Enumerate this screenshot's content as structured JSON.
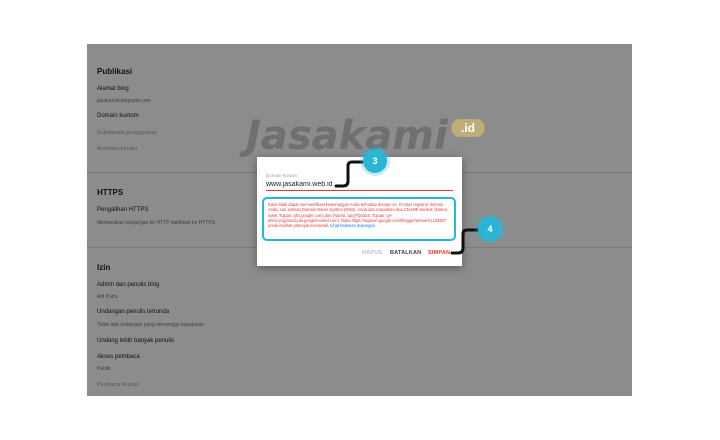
{
  "settings": {
    "publikasi": {
      "title": "Publikasi",
      "alamat_blog_label": "Alamat blog",
      "alamat_blog_value": "jasakamid.blogspot.com",
      "domain_kustom_label": "Domain kustom",
      "subdomain_label": "Subdomain penggantian",
      "arahkan_label": "Arahkan domain"
    },
    "https": {
      "title": "HTTPS",
      "pengalihan_label": "Pengalihan HTTPS",
      "pengalihan_sub": "Memastikan kunjungan ke HTTP dialihkan ke HTTPS"
    },
    "izin": {
      "title": "Izin",
      "admin_label": "Admin dan penulis blog",
      "admin_value": "Adi Putra",
      "undangan_label": "Undangan penulis tertunda",
      "undangan_sub": "Tidak ada undangan yang menunggu keputusan",
      "undang_lebih_label": "Undang lebih banyak penulis",
      "akses_label": "Akses pembaca",
      "akses_value": "Publik",
      "pembaca_khusus_label": "Pembaca khusus"
    }
  },
  "watermark": {
    "text": "Jasakami",
    "badge": ".id"
  },
  "dialog": {
    "field_label": "Domain kustom",
    "domain_value": "www.jasakami.web.id",
    "error_message": "Kami tidak dapat memverifikasi kewenangan Anda terhadap domain ini. Di situs registrar domain Anda, cari setelan Domain Name System (DNS). Anda dan masukkan dua CNAME berikut: (Nama: www, Tujuan: ghs.google.com) dan (Nama: apoj7fpv3u6, Tujuan: gv-ebnzcyzgdmu2q.dv.googlehosted.com). Buka https://support.google.com/blogger/answer/1233387 untuk melihat petunjuk mendetail.",
    "error_link": "Lihat halaman dukungan",
    "hapus_label": "HAPUS",
    "batalkan_label": "BATALKAN",
    "simpan_label": "SIMPAN"
  },
  "callouts": {
    "step3": "3",
    "step4": "4"
  },
  "colors": {
    "accent_cyan": "#29b6d6",
    "error_red": "#e53935",
    "link_blue": "#1a73e8"
  }
}
